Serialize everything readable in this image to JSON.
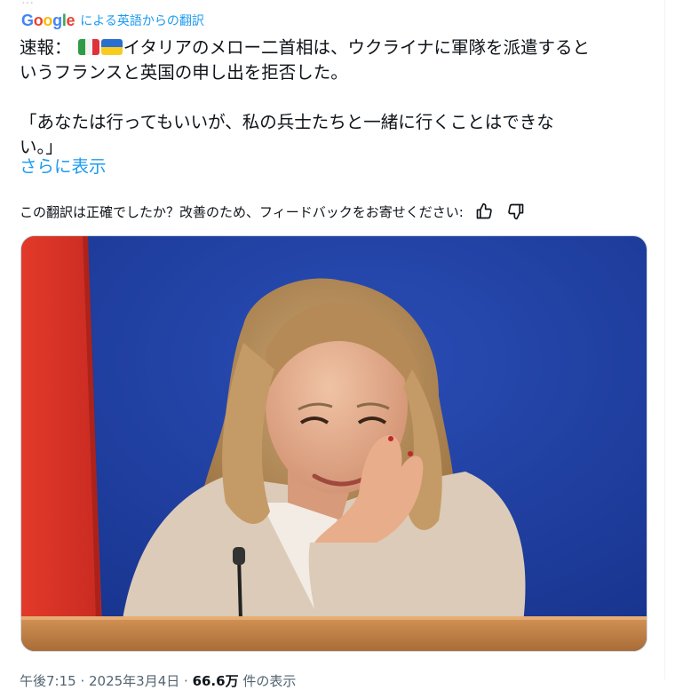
{
  "translation": {
    "google_logo": "Google",
    "label": "による英語からの翻訳",
    "colors": {
      "g_blue": "#4285F4",
      "g_red": "#EA4335",
      "g_yellow": "#FBBC05",
      "g_green": "#34A853",
      "link": "#1d9bf0"
    }
  },
  "tweet": {
    "breaking_label": "速報：",
    "flags": [
      "italy-flag",
      "ukraine-flag"
    ],
    "line1_rest": "イタリアのメロー二首相は、ウクライナに軍隊を派遣すると",
    "line2": "いうフランスと英国の申し出を拒否した。",
    "quote_line1": "「あなたは行ってもいいが、私の兵士たちと一緒に行くことはできな",
    "quote_line2": "い。」",
    "show_more": "さらに表示"
  },
  "feedback": {
    "question": "この翻訳は正確でしたか？改善のため、フィードバックをお寄せください:",
    "thumbs_up_icon": "thumbs-up-icon",
    "thumbs_down_icon": "thumbs-down-icon"
  },
  "media": {
    "photo_icon": "photo-of-woman-smiling-at-podium"
  },
  "meta": {
    "time": "午後7:15 · 2025年3月4日 · ",
    "views_count": "66.6万",
    "views_label": " 件の表示"
  }
}
